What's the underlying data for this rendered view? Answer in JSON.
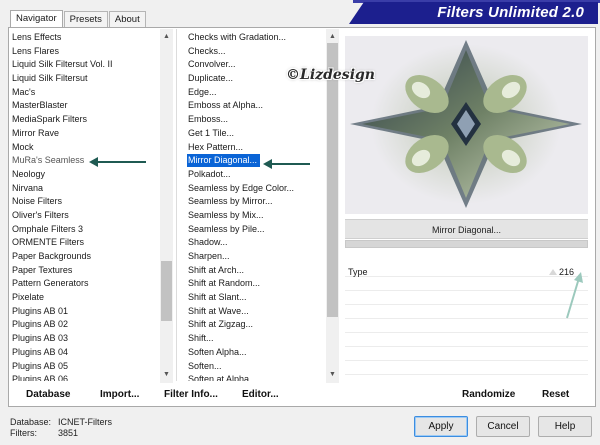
{
  "tabs": [
    {
      "label": "Navigator",
      "active": true
    },
    {
      "label": "Presets",
      "active": false
    },
    {
      "label": "About",
      "active": false
    }
  ],
  "banner": {
    "title": "Filters Unlimited 2.0",
    "color": "#1c1f8e"
  },
  "watermark": {
    "text": "Lizdesign",
    "symbol": "©"
  },
  "categories": {
    "items": [
      "Lens Effects",
      "Lens Flares",
      "Liquid Silk Filtersut Vol. II",
      "Liquid Silk Filtersut",
      "Mac's",
      "MasterBlaster",
      "MediaSpark Filters",
      "Mirror Rave",
      "Mock",
      "MuRa's Seamless",
      "Neology",
      "Nirvana",
      "Noise Filters",
      "Oliver's Filters",
      "Omphale Filters 3",
      "ORMENTE Filters",
      "Paper Backgrounds",
      "Paper Textures",
      "Pattern Generators",
      "Pixelate",
      "Plugins AB 01",
      "Plugins AB 02",
      "Plugins AB 03",
      "Plugins AB 04",
      "Plugins AB 05",
      "Plugins AB 06"
    ],
    "selected": "MuRa's Seamless"
  },
  "filters": {
    "items": [
      "Checks with Gradation...",
      "Checks...",
      "Convolver...",
      "Duplicate...",
      "Edge...",
      "Emboss at Alpha...",
      "Emboss...",
      "Get 1 Tile...",
      "Hex Pattern...",
      "Mirror Diagonal...",
      "Polkadot...",
      "Seamless by Edge Color...",
      "Seamless by Mirror...",
      "Seamless by Mix...",
      "Seamless by Pile...",
      "Shadow...",
      "Sharpen...",
      "Shift at Arch...",
      "Shift at Random...",
      "Shift at Slant...",
      "Shift at Wave...",
      "Shift at Zigzag...",
      "Shift...",
      "Soften Alpha...",
      "Soften...",
      "Soften at Alpha..."
    ],
    "selected": "Mirror Diagonal..."
  },
  "preview": {
    "filter_name": "Mirror Diagonal...",
    "icon": "kaleidoscope-preview"
  },
  "params": [
    {
      "label": "Type",
      "value": "216"
    }
  ],
  "left_buttons": {
    "database": "Database",
    "import": "Import...",
    "filter_info": "Filter Info...",
    "editor": "Editor..."
  },
  "right_buttons": {
    "randomize": "Randomize",
    "reset": "Reset"
  },
  "status": {
    "database_label": "Database:",
    "database_value": "ICNET-Filters",
    "filters_label": "Filters:",
    "filters_value": "3851"
  },
  "dialog_buttons": {
    "apply": "Apply",
    "cancel": "Cancel",
    "help": "Help"
  },
  "colors": {
    "selection": "#0a64d6",
    "arrow": "#1f5a52",
    "arrow_light": "#9cc9bd"
  }
}
